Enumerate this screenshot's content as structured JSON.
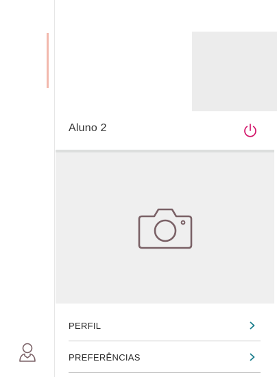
{
  "profile": {
    "user_name": "Aluno 2"
  },
  "icons": {
    "power": "power-icon",
    "camera": "camera-icon",
    "user": "user-icon",
    "chevron": "chevron-right-icon"
  },
  "menu": {
    "items": [
      {
        "label": "PERFIL"
      },
      {
        "label": "PREFERÊNCIAS"
      }
    ]
  },
  "colors": {
    "accent_power": "#d3156a",
    "chevron": "#1a7d8c",
    "camera_stroke": "#7a6166",
    "active_indicator": "#f2b8ad",
    "photo_bg": "#efefef"
  }
}
